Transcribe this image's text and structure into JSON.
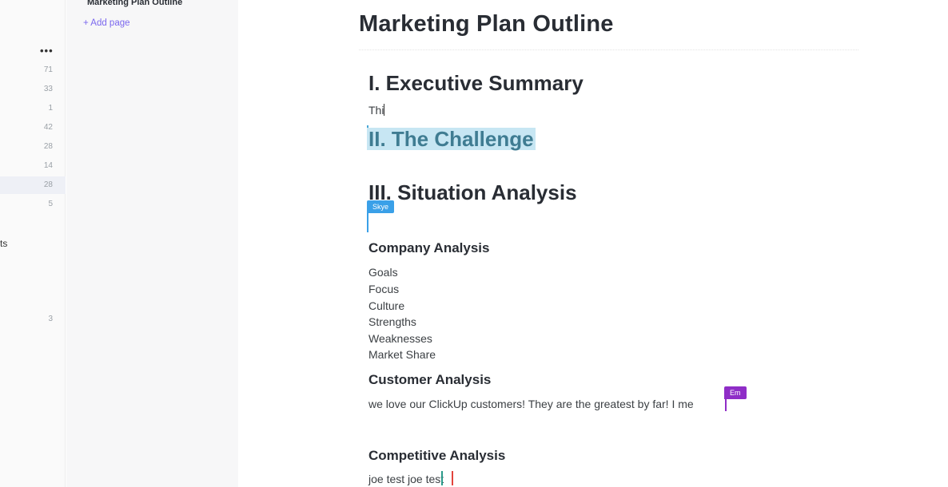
{
  "sidebar": {
    "more_icon": "•••",
    "counts": [
      "71",
      "33",
      "1",
      "42",
      "28",
      "14",
      "28",
      "5",
      "3"
    ],
    "partial_label": "ts"
  },
  "pages": {
    "current_page": "Marketing Plan Outline",
    "add_page": "+ Add page"
  },
  "doc": {
    "title": "Marketing Plan Outline",
    "sections": {
      "executive_summary": "I. Executive Summary",
      "executive_text": "Thi",
      "challenge": "II. The Challenge",
      "situation": "III. Situation Analysis",
      "company_analysis": "Company Analysis",
      "company_items": [
        "Goals",
        "Focus",
        "Culture",
        "Strengths",
        "Weaknesses",
        "Market Share"
      ],
      "customer_analysis": "Customer Analysis",
      "customer_text": "we love our ClickUp customers! They are the greatest by far! I me",
      "competitive_analysis": "Competitive Analysis",
      "competitive_text": "joe test joe test"
    }
  },
  "collaborators": {
    "skye": "Skye",
    "em": "Em"
  },
  "colors": {
    "accent": "#7b68ee",
    "highlight": "#c7e6f3",
    "skye": "#3aa0e8",
    "em": "#8f2dc7"
  }
}
